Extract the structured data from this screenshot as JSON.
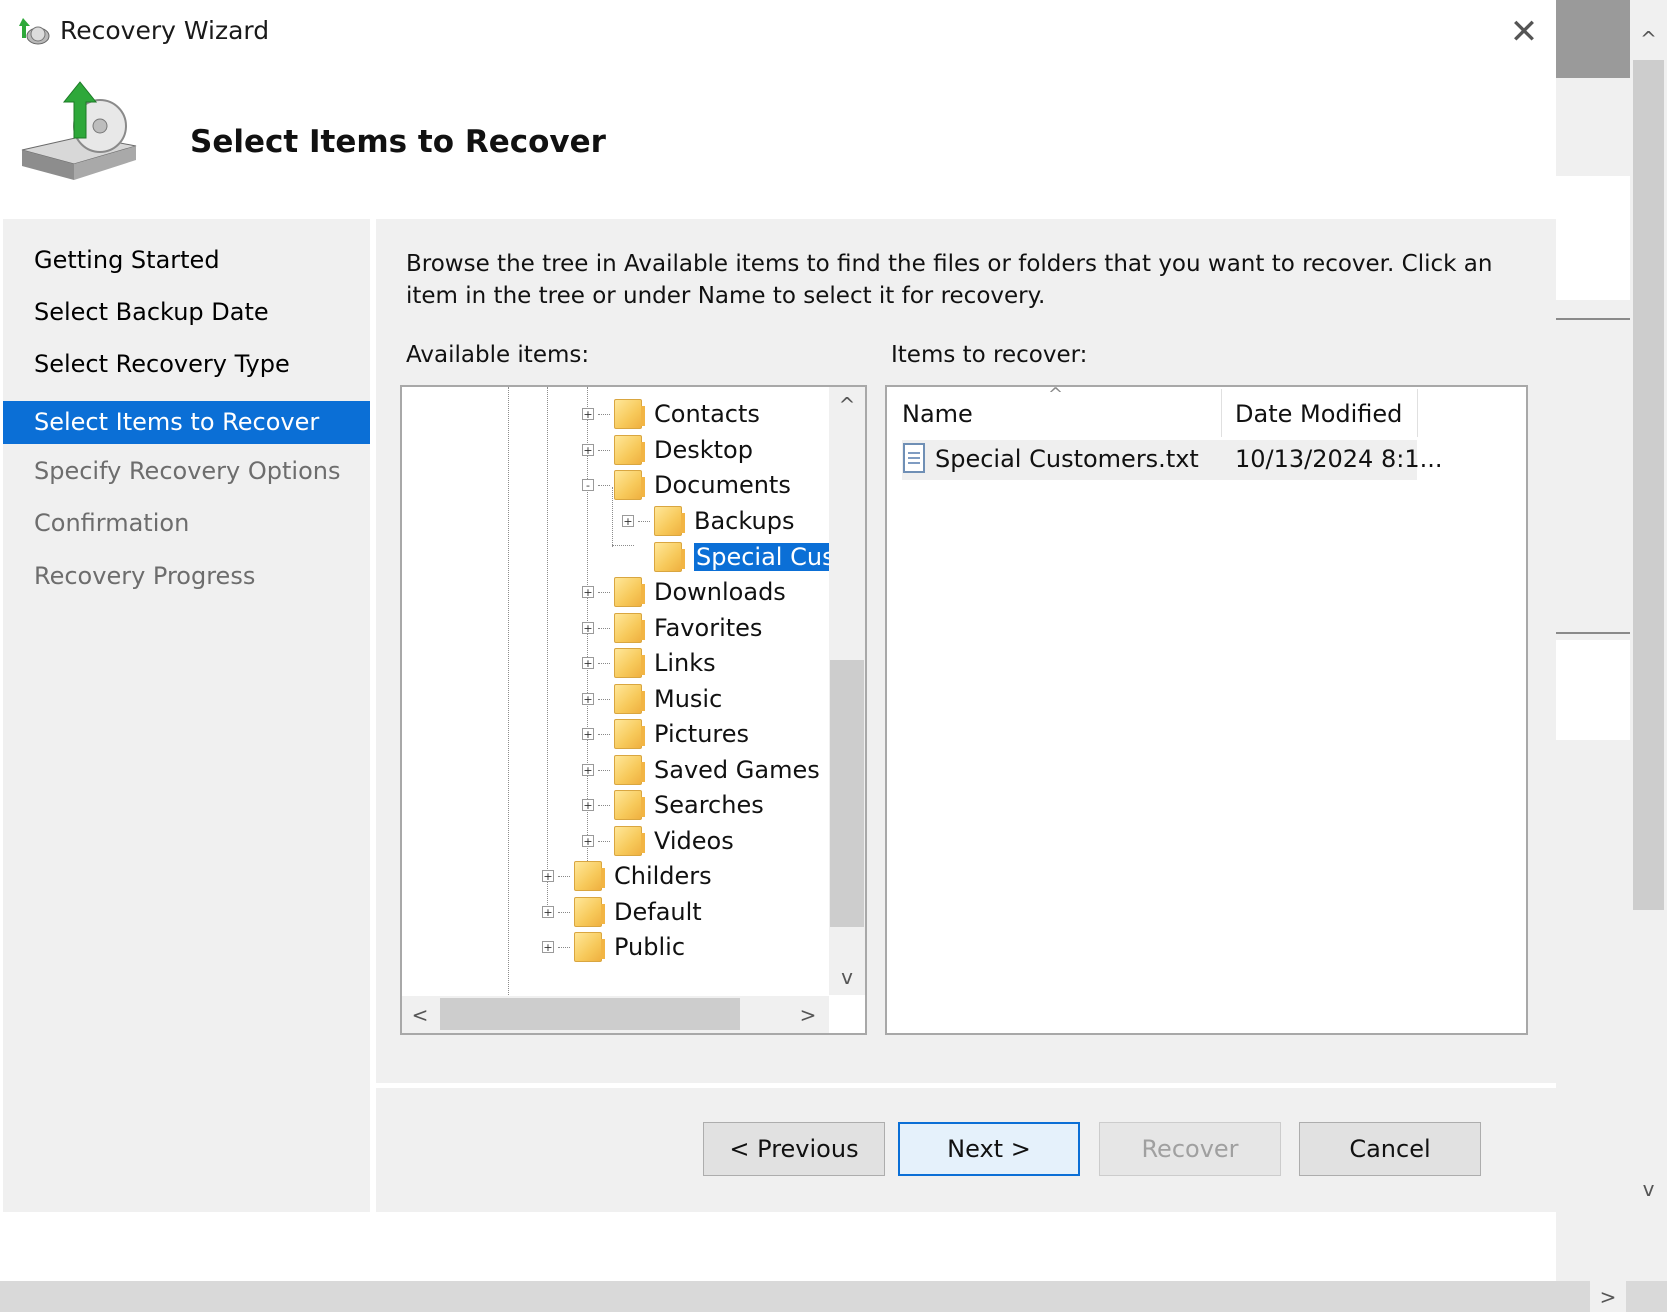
{
  "window": {
    "title": "Recovery Wizard",
    "close_glyph": "✕"
  },
  "page": {
    "title": "Select Items to Recover",
    "instructions": "Browse the tree in Available items to find the files or folders that you want to recover. Click an item in the tree or under Name to select it for recovery."
  },
  "nav": {
    "items": [
      {
        "label": "Getting Started",
        "state": "done"
      },
      {
        "label": "Select Backup Date",
        "state": "done"
      },
      {
        "label": "Select Recovery Type",
        "state": "done"
      },
      {
        "label": "Select Items to Recover",
        "state": "active"
      },
      {
        "label": "Specify Recovery Options",
        "state": "todo"
      },
      {
        "label": "Confirmation",
        "state": "todo"
      },
      {
        "label": "Recovery Progress",
        "state": "todo"
      }
    ]
  },
  "available_items": {
    "label": "Available items:",
    "tree": [
      {
        "label": "Contacts",
        "expander": "+"
      },
      {
        "label": "Desktop",
        "expander": "+"
      },
      {
        "label": "Documents",
        "expander": "-"
      },
      {
        "label": "Backups",
        "expander": "+"
      },
      {
        "label": "Special Cust",
        "expander": "",
        "selected": true
      },
      {
        "label": "Downloads",
        "expander": "+"
      },
      {
        "label": "Favorites",
        "expander": "+"
      },
      {
        "label": "Links",
        "expander": "+"
      },
      {
        "label": "Music",
        "expander": "+"
      },
      {
        "label": "Pictures",
        "expander": "+"
      },
      {
        "label": "Saved Games",
        "expander": "+"
      },
      {
        "label": "Searches",
        "expander": "+"
      },
      {
        "label": "Videos",
        "expander": "+"
      },
      {
        "label": "Childers",
        "expander": "+"
      },
      {
        "label": "Default",
        "expander": "+"
      },
      {
        "label": "Public",
        "expander": "+"
      }
    ]
  },
  "items_to_recover": {
    "label": "Items to recover:",
    "columns": [
      "Name",
      "Date Modified"
    ],
    "rows": [
      {
        "name": "Special Customers.txt",
        "date_modified": "10/13/2024 8:1..."
      }
    ]
  },
  "buttons": {
    "previous": "< Previous",
    "next": "Next >",
    "recover": "Recover",
    "cancel": "Cancel"
  },
  "colors": {
    "accent": "#0b6fd6",
    "panel": "#f0f0f0"
  },
  "icons": {
    "app": "recovery-wizard-icon",
    "header": "disk-recovery-icon",
    "folder": "folder-icon",
    "file": "text-file-icon"
  }
}
